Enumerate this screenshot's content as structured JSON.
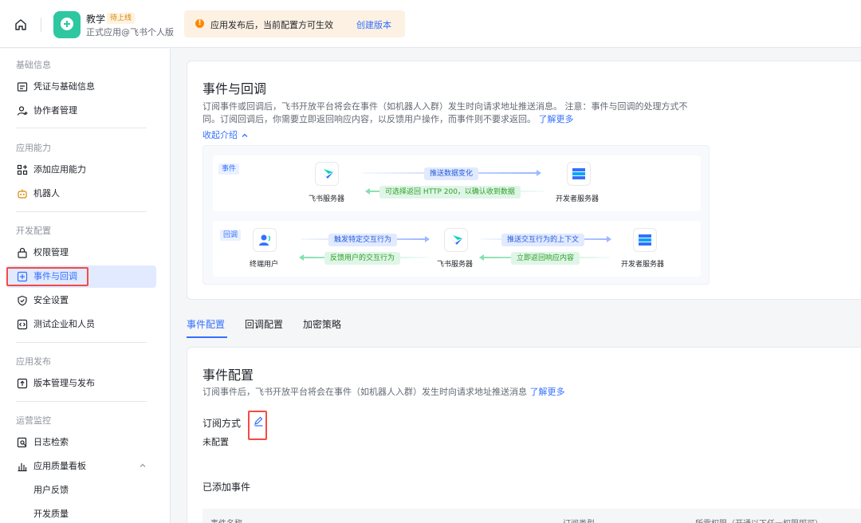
{
  "topbar": {
    "app_name": "教学",
    "status_tag": "待上线",
    "app_subtitle": "正式应用@飞书个人版",
    "notice_text": "应用发布后，当前配置方可生效",
    "notice_link": "创建版本"
  },
  "sidebar": {
    "sections": [
      {
        "title": "基础信息",
        "items": [
          "凭证与基础信息",
          "协作者管理"
        ]
      },
      {
        "title": "应用能力",
        "items": [
          "添加应用能力",
          "机器人"
        ]
      },
      {
        "title": "开发配置",
        "items": [
          "权限管理",
          "事件与回调",
          "安全设置",
          "测试企业和人员"
        ]
      },
      {
        "title": "应用发布",
        "items": [
          "版本管理与发布"
        ]
      },
      {
        "title": "运营监控",
        "items": [
          "日志检索",
          "应用质量看板",
          "用户反馈",
          "开发质量"
        ]
      }
    ],
    "active_item": "事件与回调"
  },
  "intro": {
    "title": "事件与回调",
    "desc_line1": "订阅事件或回调后，飞书开放平台将会在事件（如机器人入群）发生时向请求地址推送消息。 注意：事件与回调的处理方式不",
    "desc_line2": "同。订阅回调后，你需要立即返回响应内容，以反馈用户操作，而事件则不要求返回。",
    "learn_more": "了解更多",
    "collapse": "收起介绍"
  },
  "diagram": {
    "event_tag": "事件",
    "callback_tag": "回调",
    "event_left_node": "飞书服务器",
    "event_right_node": "开发者服务器",
    "event_push": "推送数据变化",
    "event_return": "可选择返回 HTTP 200，以确认收到数据",
    "cb_user": "终端用户",
    "cb_mid": "飞书服务器",
    "cb_dev": "开发者服务器",
    "cb_trigger": "触发特定交互行为",
    "cb_feedback": "反馈用户的交互行为",
    "cb_push": "推送交互行为的上下文",
    "cb_return": "立即返回响应内容"
  },
  "tabs": [
    "事件配置",
    "回调配置",
    "加密策略"
  ],
  "event_config": {
    "title": "事件配置",
    "desc": "订阅事件后，飞书开放平台将会在事件（如机器人入群）发生时向请求地址推送消息",
    "learn_more": "了解更多",
    "subscription_label": "订阅方式",
    "subscription_value": "未配置",
    "added_events": "已添加事件",
    "table_headers": [
      "事件名称",
      "订阅类型",
      "所需权限（开通以下任一权限即可）"
    ]
  },
  "colors": {
    "accent": "#3370ff",
    "highlight": "#f54a45",
    "app_icon": "#2ec7a0"
  }
}
